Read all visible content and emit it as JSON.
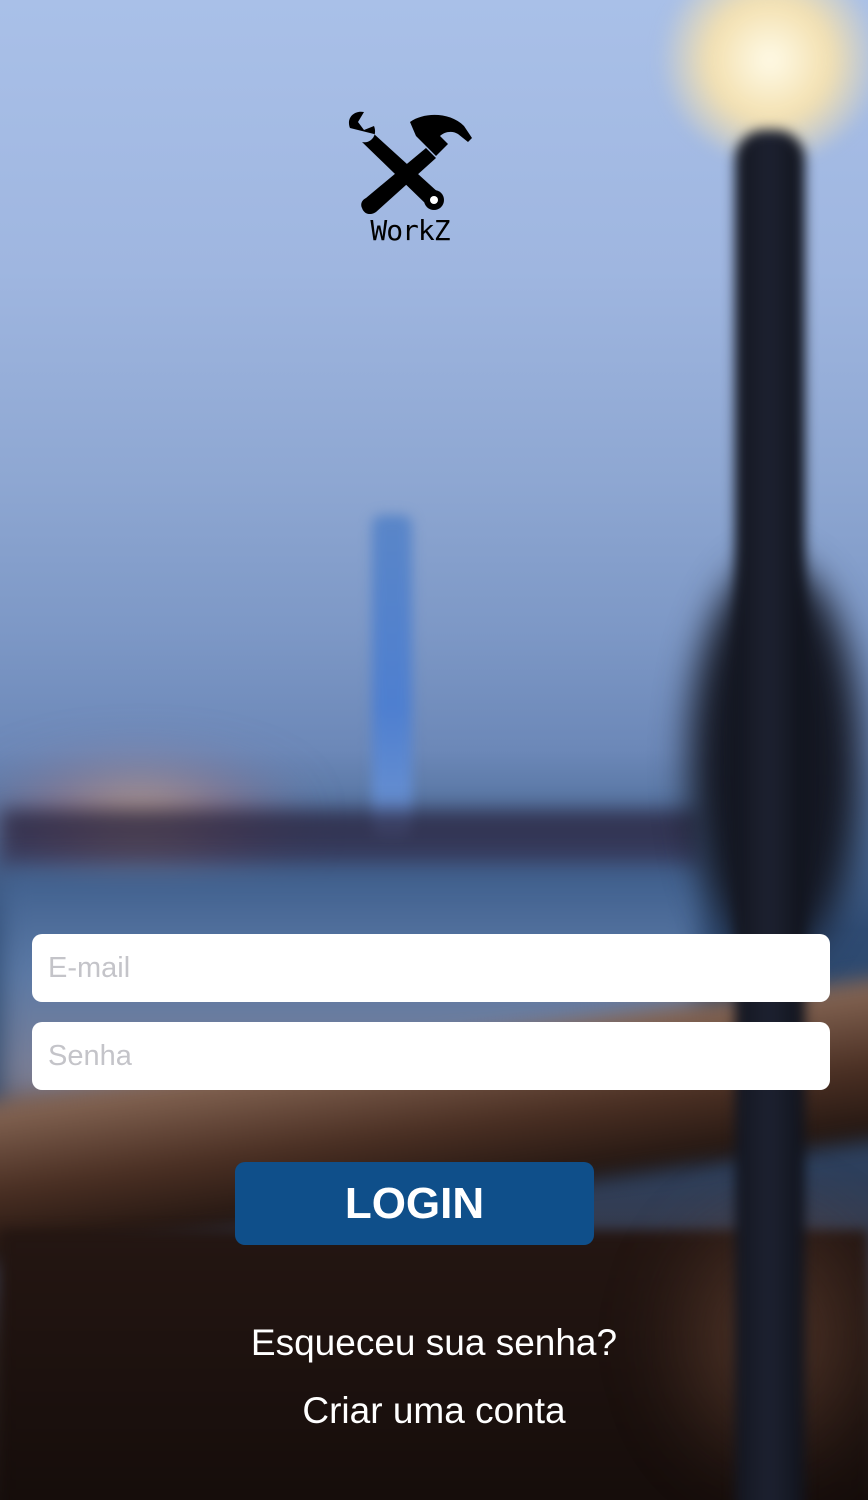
{
  "app": {
    "name": "WorkZ",
    "logo_icon": "wrench-hammer-icon"
  },
  "form": {
    "email_placeholder": "E-mail",
    "email_value": "",
    "password_placeholder": "Senha",
    "password_value": ""
  },
  "actions": {
    "login_label": "LOGIN",
    "forgot_password_label": "Esqueceu sua senha?",
    "create_account_label": "Criar uma conta"
  },
  "colors": {
    "primary_button": "#0F4F8A",
    "field_background": "#FFFFFF",
    "placeholder": "#C4C4C9",
    "link_text": "#FFFFFF"
  }
}
